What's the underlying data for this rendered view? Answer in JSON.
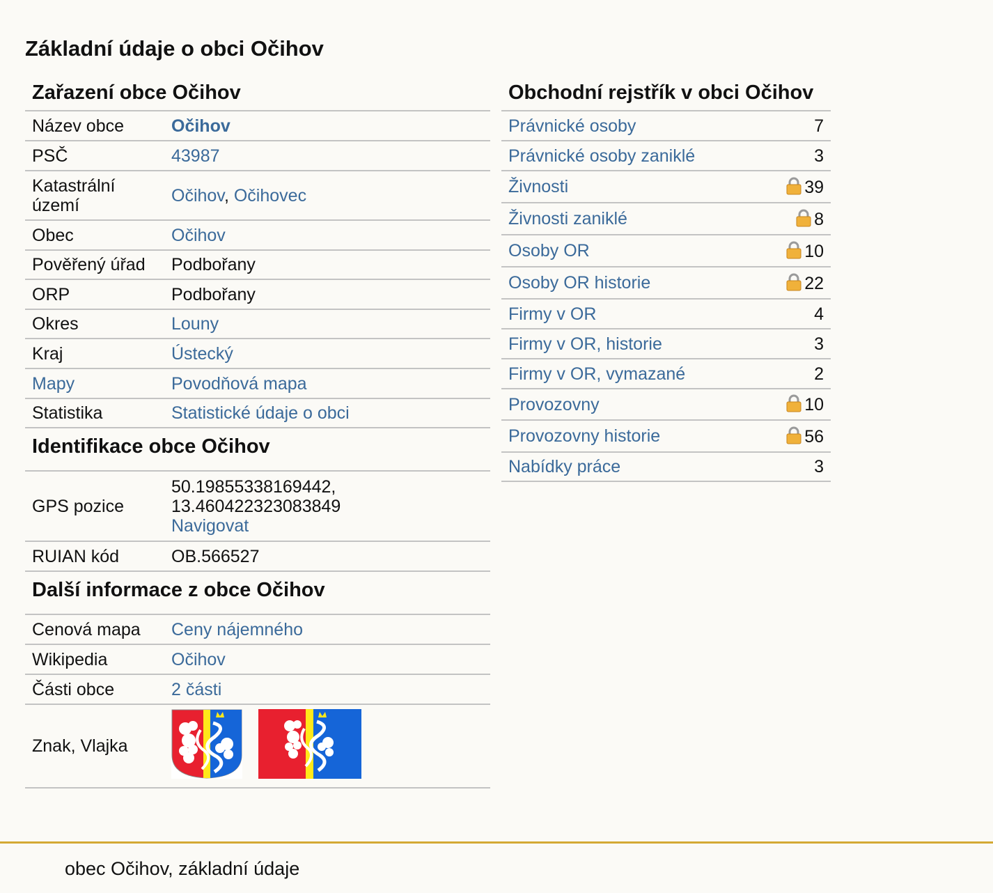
{
  "page": {
    "title": "Základní údaje o obci Očihov"
  },
  "zarazeni": {
    "title": "Zařazení obce Očihov",
    "rows": [
      {
        "key": "Název obce",
        "value": "Očihov"
      },
      {
        "key": "PSČ",
        "value": "43987"
      },
      {
        "key": "Katastrální území",
        "value_1": "Očihov",
        "sep": ", ",
        "value_2": "Očihovec"
      },
      {
        "key": "Obec",
        "value": "Očihov"
      },
      {
        "key": "Pověřený úřad",
        "value": "Podbořany"
      },
      {
        "key": "ORP",
        "value": "Podbořany"
      },
      {
        "key": "Okres",
        "value": "Louny"
      },
      {
        "key": "Kraj",
        "value": "Ústecký"
      },
      {
        "key": "Mapy",
        "value": "Povodňová mapa"
      },
      {
        "key": "Statistika",
        "value": "Statistické údaje o obci"
      }
    ]
  },
  "identifikace": {
    "title": "Identifikace obce Očihov",
    "gps": {
      "key": "GPS pozice",
      "lat": "50.19855338169442,",
      "lon": "13.460422323083849",
      "link": "Navigovat"
    },
    "ruian": {
      "key": "RUIAN kód",
      "value": "OB.566527"
    }
  },
  "dalsi": {
    "title": "Další informace z obce Očihov",
    "rows": [
      {
        "key": "Cenová mapa",
        "value": "Ceny nájemného"
      },
      {
        "key": "Wikipedia",
        "value": "Očihov"
      },
      {
        "key": "Části obce",
        "value": "2 části"
      },
      {
        "key": "Znak, Vlajka"
      }
    ]
  },
  "rejstrik": {
    "title": "Obchodní rejstřík v obci Očihov",
    "rows": [
      {
        "label": "Právnické osoby",
        "count": "7",
        "locked": false
      },
      {
        "label": "Právnické osoby zaniklé",
        "count": "3",
        "locked": false
      },
      {
        "label": "Živnosti",
        "count": "39",
        "locked": true
      },
      {
        "label": "Živnosti zaniklé",
        "count": "8",
        "locked": true
      },
      {
        "label": "Osoby OR",
        "count": "10",
        "locked": true
      },
      {
        "label": "Osoby OR historie",
        "count": "22",
        "locked": true
      },
      {
        "label": "Firmy v OR",
        "count": "4",
        "locked": false
      },
      {
        "label": "Firmy v OR, historie",
        "count": "3",
        "locked": false
      },
      {
        "label": "Firmy v OR, vymazané",
        "count": "2",
        "locked": false
      },
      {
        "label": "Provozovny",
        "count": "10",
        "locked": true
      },
      {
        "label": "Provozovny historie",
        "count": "56",
        "locked": true
      },
      {
        "label": "Nabídky práce",
        "count": "3",
        "locked": false
      }
    ]
  },
  "footer": {
    "text": "obec Očihov, základní údaje"
  },
  "colors": {
    "link": "#3b6a9a",
    "footer_line": "#d4a934",
    "background": "#fbfaf6",
    "emblem_red": "#e8202f",
    "emblem_blue": "#1565d8",
    "emblem_yellow": "#ffe81a"
  }
}
